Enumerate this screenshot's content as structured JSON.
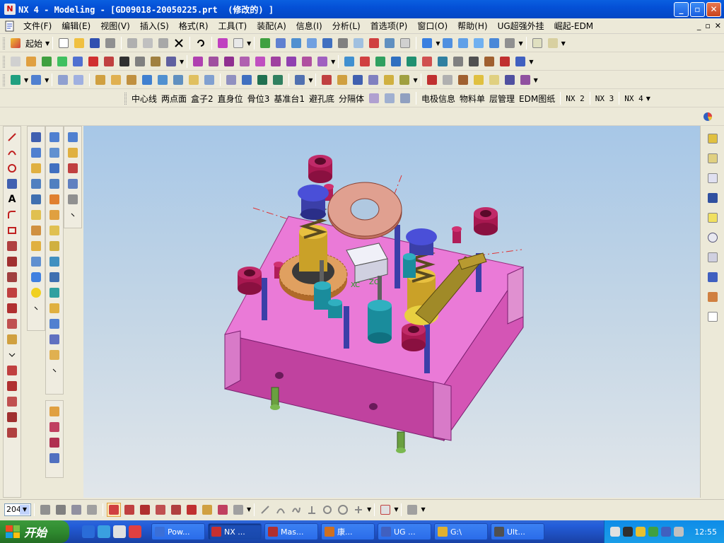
{
  "window": {
    "title": "NX 4 - Modeling - [GD09018-20050225.prt  (修改的) ]",
    "min": "_",
    "max": "▫",
    "close": "✕"
  },
  "menu": {
    "items": [
      "文件(F)",
      "编辑(E)",
      "视图(V)",
      "插入(S)",
      "格式(R)",
      "工具(T)",
      "装配(A)",
      "信息(I)",
      "分析(L)",
      "首选项(P)",
      "窗口(O)",
      "帮助(H)",
      "UG超强外挂",
      "崛起-EDM"
    ],
    "mdi_min": "_",
    "mdi_max": "▫",
    "mdi_close": "✕"
  },
  "toolbar2": {
    "start_label": "起始"
  },
  "toolbar5": {
    "buttons": [
      "中心线",
      "两点面",
      "盒子2",
      "直身位",
      "骨位3",
      "基准台1",
      "避孔底",
      "分隔体",
      "电极信息",
      "物料单",
      "层管理",
      "EDM图纸",
      "NX 2",
      "NX 3",
      "NX 4"
    ]
  },
  "bottom": {
    "zoom": "204"
  },
  "taskbar": {
    "start": "开始",
    "tasks": [
      {
        "label": "Pow...",
        "color": "#3a6fd8"
      },
      {
        "label": "NX ...",
        "color": "#c83030"
      },
      {
        "label": "Mas...",
        "color": "#b03030"
      },
      {
        "label": "康...",
        "color": "#d07020"
      },
      {
        "label": "UG ...",
        "color": "#4060c0"
      },
      {
        "label": "G:\\",
        "color": "#e0b030"
      },
      {
        "label": "Ult...",
        "color": "#505050"
      }
    ],
    "clock": "12:55"
  },
  "colors": {
    "plate": "#ea7ad7",
    "plate_dark": "#c0429f",
    "bushing": "#b01d58",
    "pin": "#3b3fa8",
    "gold": "#caa128",
    "gear": "#e0a060",
    "teal": "#1a8c9c",
    "viewport_top": "#a7c7e7"
  }
}
